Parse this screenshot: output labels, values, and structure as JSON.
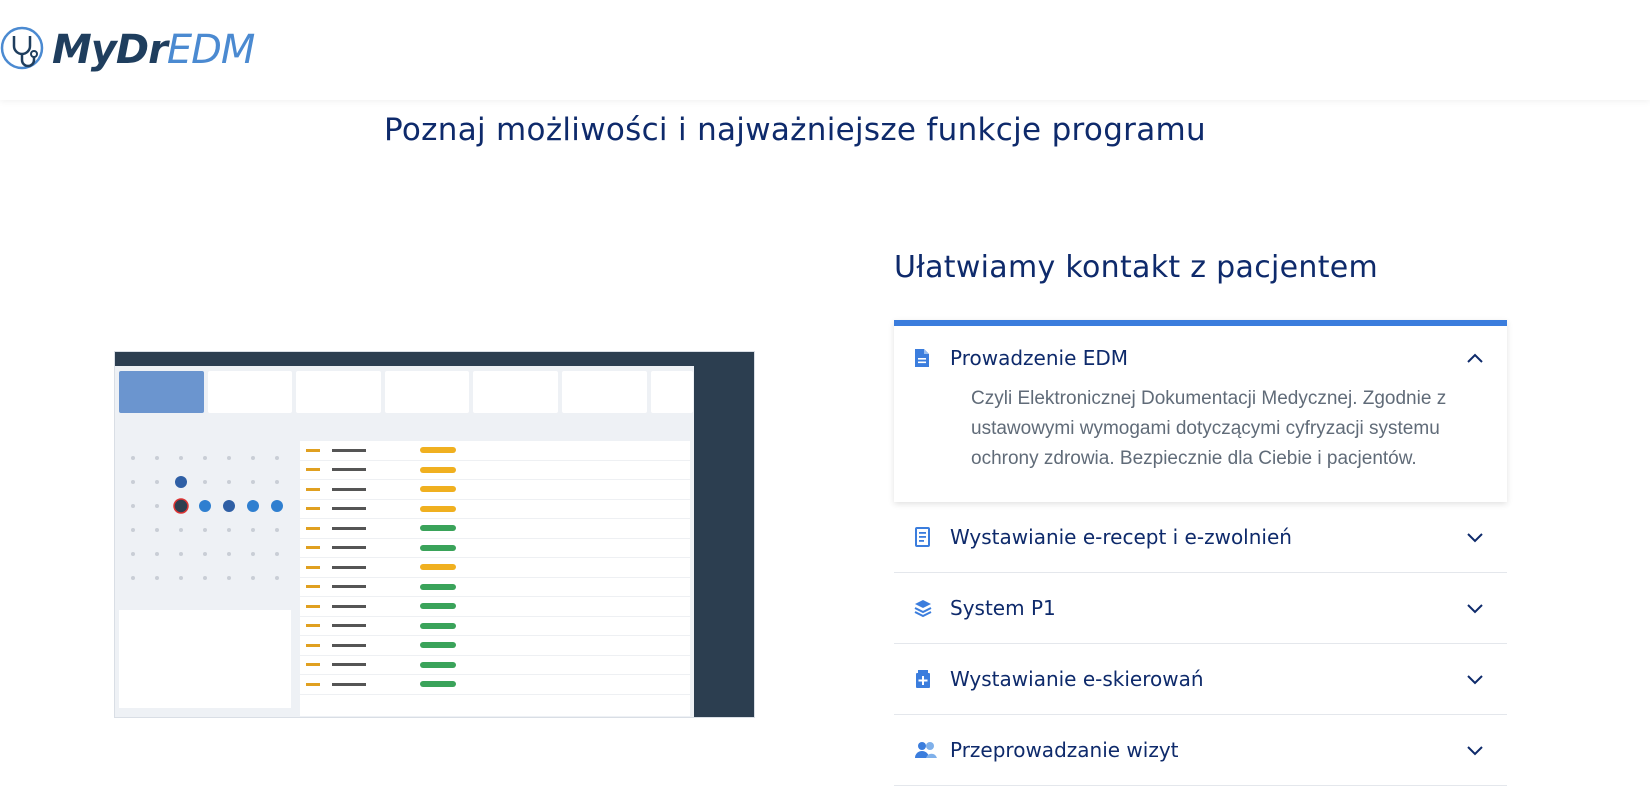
{
  "header": {
    "logo_text_a": "MyDr",
    "logo_text_b": "EDM"
  },
  "page": {
    "heading": "Poznaj możliwości i najważniejsze funkcje programu"
  },
  "section": {
    "title": "Ułatwiamy kontakt z pacjentem"
  },
  "accordion": {
    "items": [
      {
        "label": "Prowadzenie EDM",
        "icon": "document-icon",
        "expanded": true,
        "description": "Czyli Elektronicznej Dokumentacji Medycznej. Zgodnie z ustawowymi wymogami dotyczącymi cyfryzacji systemu ochrony zdrowia. Bezpiecznie dla Ciebie i pacjentów."
      },
      {
        "label": "Wystawianie e-recept i e-zwolnień",
        "icon": "receipt-icon",
        "expanded": false
      },
      {
        "label": "System P1",
        "icon": "layers-icon",
        "expanded": false
      },
      {
        "label": "Wystawianie e-skierowań",
        "icon": "medical-file-icon",
        "expanded": false
      },
      {
        "label": "Przeprowadzanie wizyt",
        "icon": "users-icon",
        "expanded": false
      }
    ]
  },
  "colors": {
    "brand_dark": "#0e2a6b",
    "brand_accent": "#3b7ddd",
    "text_muted": "#606b78"
  }
}
